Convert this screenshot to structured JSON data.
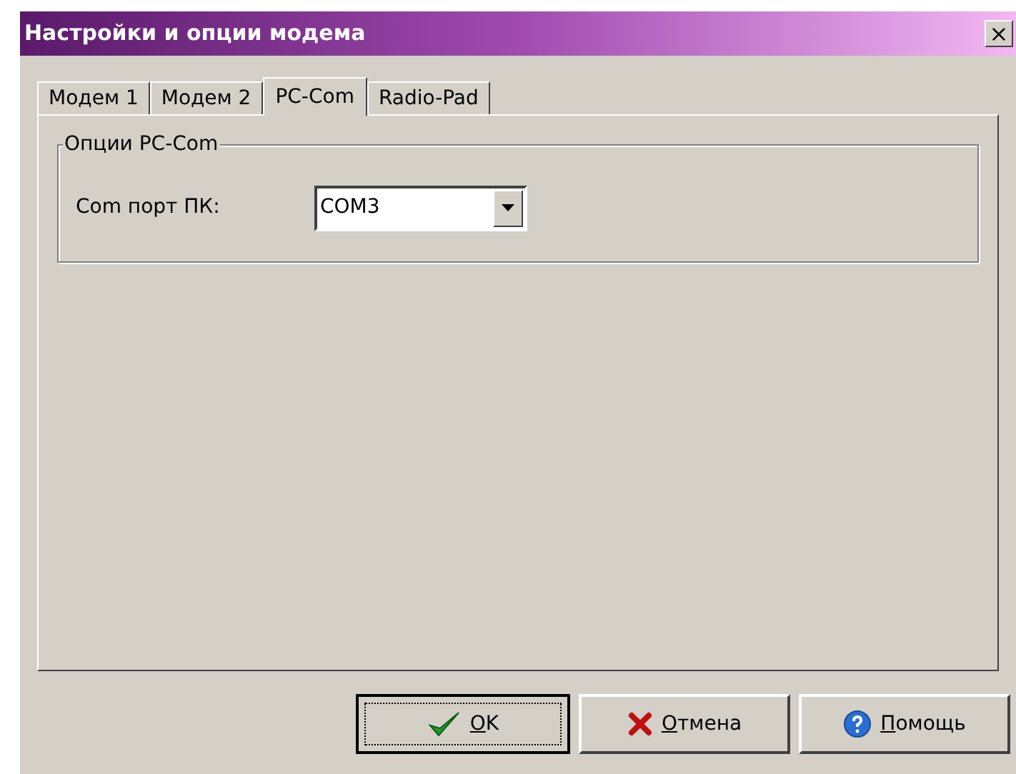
{
  "window": {
    "title": "Настройки и опции модема",
    "close": "×"
  },
  "tabs": [
    {
      "label": "Модем 1",
      "selected": false
    },
    {
      "label": "Модем 2",
      "selected": false
    },
    {
      "label": "PC-Com",
      "selected": true
    },
    {
      "label": "Radio-Pad",
      "selected": false
    }
  ],
  "group": {
    "title": "Опции PC-Com",
    "field_label": "Com порт ПК:",
    "combo_value": "COM3"
  },
  "buttons": [
    {
      "kind": "ok",
      "accel": "O",
      "rest": "K",
      "focused": true
    },
    {
      "kind": "cancel",
      "accel": "О",
      "rest": "тмена",
      "focused": false
    },
    {
      "kind": "help",
      "accel": "П",
      "rest": "омощь",
      "focused": false
    }
  ]
}
